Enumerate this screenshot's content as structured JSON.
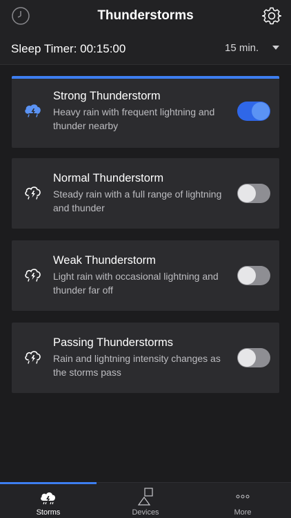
{
  "header": {
    "title": "Thunderstorms",
    "left_icon": "clock-icon",
    "right_icon": "gear-icon"
  },
  "sleep_timer": {
    "label": "Sleep Timer: 00:15:00",
    "selected": "15 min."
  },
  "storms": [
    {
      "title": "Strong Thunderstorm",
      "description": "Heavy rain with frequent lightning and thunder nearby",
      "enabled": true,
      "icon": "storm-cloud-heavy-icon"
    },
    {
      "title": "Normal Thunderstorm",
      "description": "Steady rain with a full range of lightning and thunder",
      "enabled": false,
      "icon": "storm-cloud-icon"
    },
    {
      "title": "Weak Thunderstorm",
      "description": "Light rain with occasional lightning and thunder far off",
      "enabled": false,
      "icon": "storm-cloud-icon"
    },
    {
      "title": "Passing Thunderstorms",
      "description": "Rain and lightning intensity changes as the storms pass",
      "enabled": false,
      "icon": "storm-cloud-icon"
    }
  ],
  "tabs": [
    {
      "label": "Storms",
      "icon": "storm-cloud-icon",
      "active": true
    },
    {
      "label": "Devices",
      "icon": "devices-icon",
      "active": false
    },
    {
      "label": "More",
      "icon": "more-dots-icon",
      "active": false
    }
  ],
  "colors": {
    "accent": "#3d7ef0",
    "background": "#1c1c1e",
    "card": "#2c2c2f"
  }
}
